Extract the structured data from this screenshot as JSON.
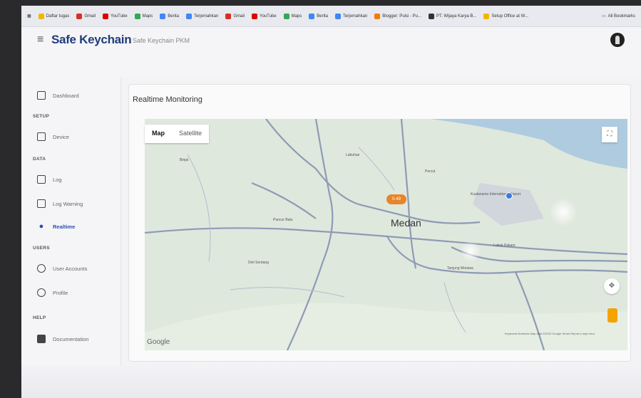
{
  "browser": {
    "bookmarks": [
      {
        "label": "Daftar tugas",
        "color": "#f2b600",
        "icon": "checklist-icon"
      },
      {
        "label": "Gmail",
        "color": "#d93025",
        "icon": "gmail-icon"
      },
      {
        "label": "YouTube",
        "color": "#e00000",
        "icon": "youtube-icon"
      },
      {
        "label": "Maps",
        "color": "#34a853",
        "icon": "maps-icon"
      },
      {
        "label": "Berita",
        "color": "#4285f4",
        "icon": "news-icon"
      },
      {
        "label": "Terjemahkan",
        "color": "#4285f4",
        "icon": "translate-icon"
      },
      {
        "label": "Gmail",
        "color": "#d93025",
        "icon": "gmail-icon"
      },
      {
        "label": "YouTube",
        "color": "#e00000",
        "icon": "youtube-icon"
      },
      {
        "label": "Maps",
        "color": "#34a853",
        "icon": "maps-icon"
      },
      {
        "label": "Berita",
        "color": "#4285f4",
        "icon": "news-icon"
      },
      {
        "label": "Terjemahkan",
        "color": "#4285f4",
        "icon": "translate-icon"
      },
      {
        "label": "Blogger: Pulsi - Pu...",
        "color": "#f57c00",
        "icon": "blogger-icon"
      },
      {
        "label": "PT. Wijaya Karya B...",
        "color": "#333333",
        "icon": "site-icon"
      },
      {
        "label": "Setup Office at W...",
        "color": "#f2b600",
        "icon": "office-icon"
      }
    ],
    "all_bookmarks": "All Bookmarks"
  },
  "header": {
    "brand": "Safe Keychain",
    "subtitle": "Safe Keychain PKM"
  },
  "sidebar": {
    "dashboard": "Dashboard",
    "section_setup": "SETUP",
    "device": "Device",
    "section_data": "DATA",
    "log": "Log",
    "log_warning": "Log Warning",
    "realtime": "Realtime",
    "section_users": "USERS",
    "user_accounts": "User Accounts",
    "profile": "Profile",
    "section_help": "HELP",
    "documentation": "Documentation"
  },
  "main": {
    "card_title": "Realtime Monitoring",
    "map_tab_map": "Map",
    "map_tab_satellite": "Satellite",
    "city": "Medan",
    "marker_label": "0-49",
    "labels": {
      "binjai": "Binjai",
      "pancur_batu": "Pancur Batu",
      "deli_serdang": "Deli Serdang",
      "lubuk_pakam": "Lubuk Pakam",
      "tanjung_morawa": "Tanjung Morawa",
      "kualanamu": "Kualanamu International Airport",
      "percut": "Percut",
      "labuhan": "Labuhan"
    },
    "google": "Google",
    "attribution": "Keyboard shortcuts   Map data ©2023 Google   Terms   Report a map error"
  },
  "colors": {
    "brand": "#1f3d7a",
    "active": "#2a4fb0",
    "sea": "#aecbe0",
    "land": "#dfe8dd",
    "road": "#8e9bb5"
  }
}
